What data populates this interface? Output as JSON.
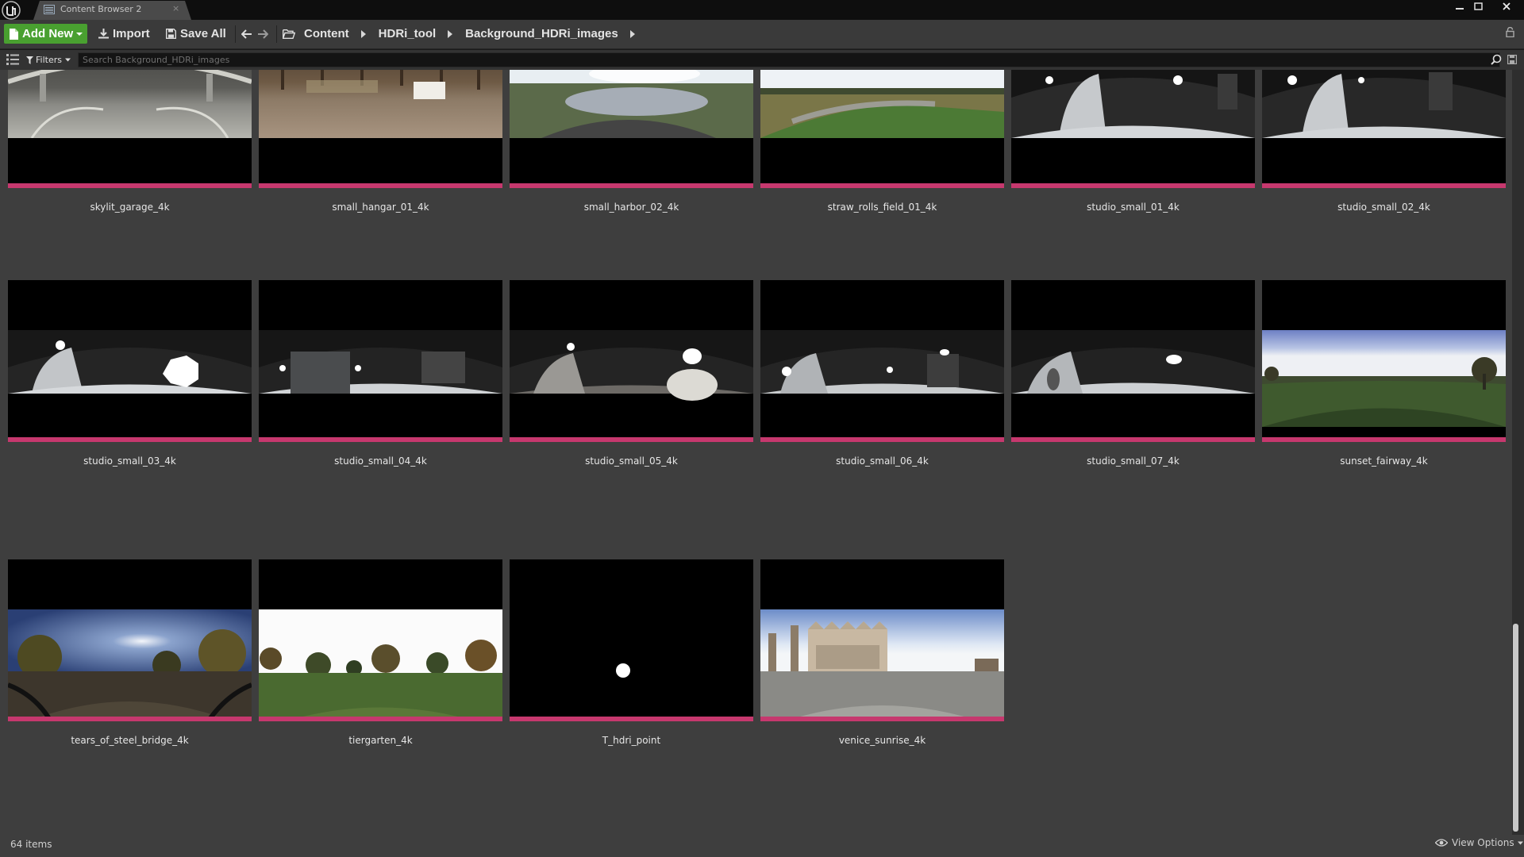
{
  "window": {
    "tab_title": "Content Browser 2",
    "tab_close": "×"
  },
  "toolbar": {
    "add_new_label": "Add New",
    "import_label": "Import",
    "save_all_label": "Save All"
  },
  "breadcrumb": [
    "Content",
    "HDRi_tool",
    "Background_HDRi_images"
  ],
  "search": {
    "filters_label": "Filters",
    "placeholder": "Search Background_HDRi_images",
    "value": ""
  },
  "assets": [
    {
      "name": "skylit_garage_4k",
      "icon": "hdri-garage-thumbnail"
    },
    {
      "name": "small_hangar_01_4k",
      "icon": "hdri-hangar-thumbnail"
    },
    {
      "name": "small_harbor_02_4k",
      "icon": "hdri-harbor-thumbnail"
    },
    {
      "name": "straw_rolls_field_01_4k",
      "icon": "hdri-field-thumbnail"
    },
    {
      "name": "studio_small_01_4k",
      "icon": "hdri-studio-thumbnail"
    },
    {
      "name": "studio_small_02_4k",
      "icon": "hdri-studio-thumbnail"
    },
    {
      "name": "studio_small_03_4k",
      "icon": "hdri-studio-thumbnail"
    },
    {
      "name": "studio_small_04_4k",
      "icon": "hdri-studio-thumbnail"
    },
    {
      "name": "studio_small_05_4k",
      "icon": "hdri-studio-thumbnail"
    },
    {
      "name": "studio_small_06_4k",
      "icon": "hdri-studio-thumbnail"
    },
    {
      "name": "studio_small_07_4k",
      "icon": "hdri-studio-thumbnail"
    },
    {
      "name": "sunset_fairway_4k",
      "icon": "hdri-fairway-thumbnail"
    },
    {
      "name": "tears_of_steel_bridge_4k",
      "icon": "hdri-bridge-thumbnail"
    },
    {
      "name": "tiergarten_4k",
      "icon": "hdri-park-thumbnail"
    },
    {
      "name": "T_hdri_point",
      "icon": "texture-point-thumbnail"
    },
    {
      "name": "venice_sunrise_4k",
      "icon": "hdri-venice-thumbnail"
    }
  ],
  "status": {
    "item_count": "64 items",
    "view_options_label": "View Options"
  },
  "colors": {
    "add_new_green": "#49a030",
    "asset_type_bar": "#c6386e",
    "window_background": "#0e0e0e"
  }
}
